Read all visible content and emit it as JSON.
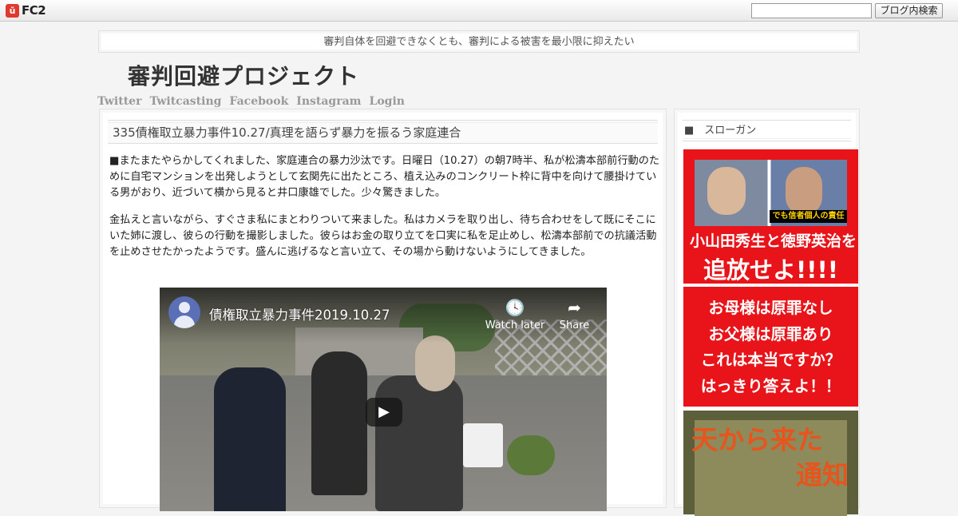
{
  "fc2": {
    "logo_mark": "ǔ",
    "logo_text": "FC2"
  },
  "search": {
    "placeholder": "",
    "button_label": "ブログ内検索"
  },
  "tagline": "審判自体を回避できなくとも、審判による被害を最小限に抑えたい",
  "site_title": "審判回避プロジェクト",
  "nav": [
    "Twitter",
    "Twitcasting",
    "Facebook",
    "Instagram",
    "Login"
  ],
  "post": {
    "title": "335債権取立暴力事件10.27/真理を語らず暴力を振るう家庭連合",
    "paragraphs": [
      "■またまたやらかしてくれました、家庭連合の暴力沙汰です。日曜日（10.27）の朝7時半、私が松濤本部前行動のために自宅マンションを出発しようとして玄関先に出たところ、植え込みのコンクリート枠に背中を向けて腰掛けている男がおり、近づいて横から見ると井口康雄でした。少々驚きました。",
      "金払えと言いながら、すぐさま私にまとわりついて来ました。私はカメラを取り出し、待ち合わせをして既にそこにいた姉に渡し、彼らの行動を撮影しました。彼らはお金の取り立てを口実に私を足止めし、松濤本部前での抗議活動を止めさせたかったようです。盛んに逃げるなと言い立て、その場から動けないようにしてきました。"
    ]
  },
  "video": {
    "title": "債権取立暴力事件2019.10.27",
    "watch_later_icon": "clock-icon",
    "watch_later": "Watch later",
    "share_icon": "share-icon",
    "share": "Share",
    "play_icon": "play-icon"
  },
  "sidebar": {
    "heading": "■　スローガン",
    "banner1": {
      "caption": "でも信者個人の責任",
      "names": "小山田秀生と徳野英治を",
      "slogan": "追放せよ!!!!"
    },
    "banner2": [
      "お母様は原罪なし",
      "お父様は原罪あり",
      "これは本当ですか？",
      "はっきり答えよ！！"
    ],
    "banner3": {
      "line1": "天から来た",
      "line2": "通知"
    }
  },
  "colors": {
    "banner_red": "#e8141a",
    "fc2_red": "#e03a2f"
  }
}
